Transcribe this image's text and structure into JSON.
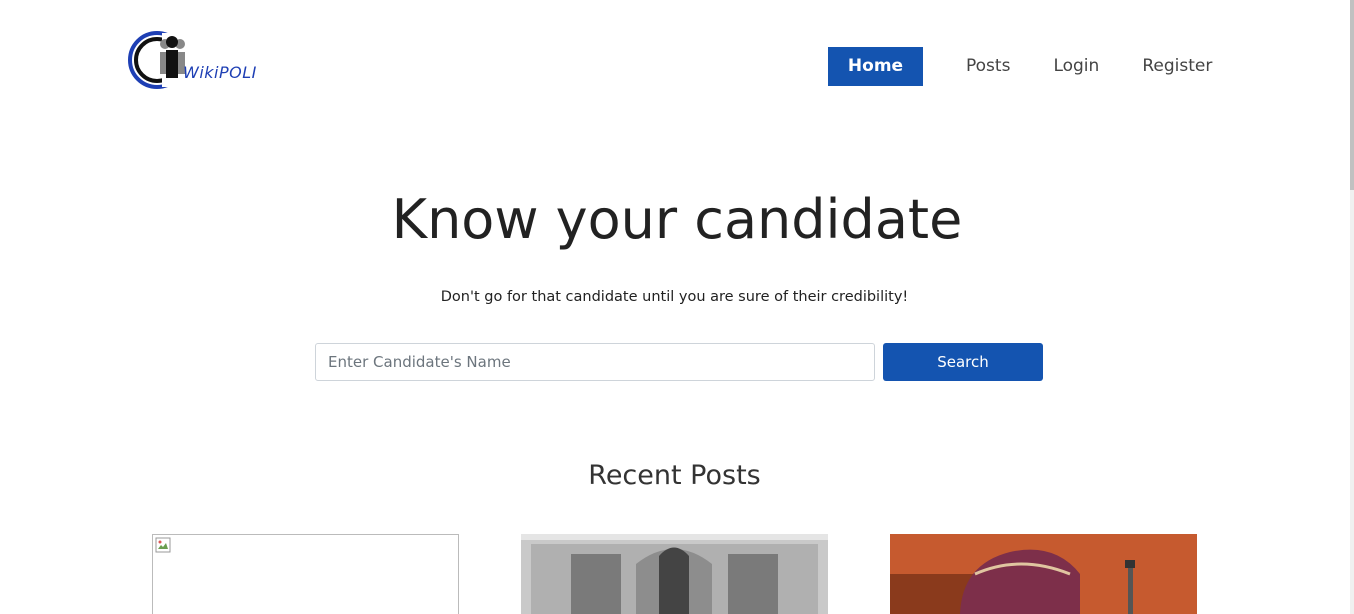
{
  "brand": {
    "name": "WikiPOLI",
    "logo_icon": "people-group-logo-icon"
  },
  "nav": {
    "items": [
      {
        "label": "Home",
        "active": true
      },
      {
        "label": "Posts",
        "active": false
      },
      {
        "label": "Login",
        "active": false
      },
      {
        "label": "Register",
        "active": false
      }
    ]
  },
  "hero": {
    "title": "Know your candidate",
    "subtitle": "Don't go for that candidate until you are sure of their credibility!"
  },
  "search": {
    "placeholder": "Enter Candidate's Name",
    "value": "",
    "button_label": "Search"
  },
  "recent_posts": {
    "title": "Recent Posts"
  },
  "colors": {
    "accent": "#1454b0",
    "logo_blue": "#1e3fb4"
  }
}
